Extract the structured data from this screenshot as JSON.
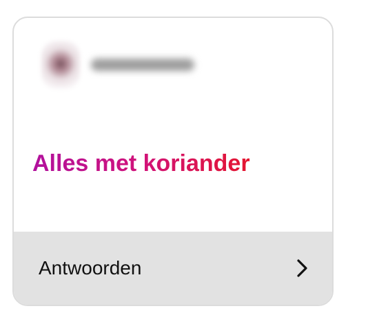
{
  "card": {
    "username": "dxxxxxjaxx",
    "question": "Alles met koriander",
    "question_gradient": [
      "#b1119d",
      "#d1137a",
      "#e4162f"
    ],
    "answer_label": "Antwoorden",
    "answer_icon": "chevron-right-icon"
  }
}
